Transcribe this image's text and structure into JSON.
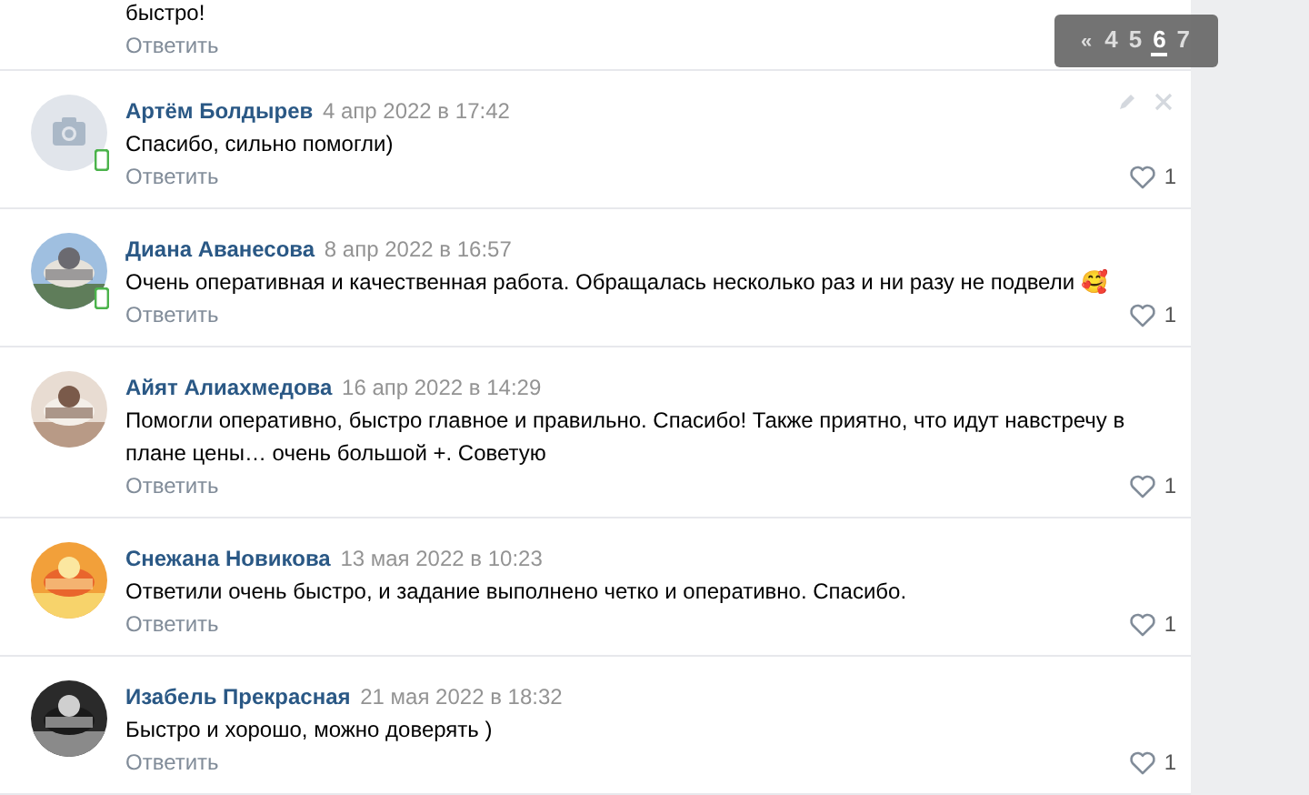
{
  "comments": [
    {
      "kind": "tail",
      "text": "быстро!",
      "reply": "Ответить"
    },
    {
      "author": "Артём Болдырев",
      "date": "4 апр 2022 в 17:42",
      "text": "Спасибо, сильно помогли)",
      "reply": "Ответить",
      "likes": "1",
      "avatar": {
        "kind": "placeholder"
      },
      "online_mobile": true,
      "hover_actions": true
    },
    {
      "author": "Диана Аванесова",
      "date": "8 апр 2022 в 16:57",
      "text": "Очень оперативная и качественная работа. Обращалась несколько раз и ни разу не подвели 🥰",
      "reply": "Ответить",
      "likes": "1",
      "online_mobile": true,
      "hover_actions": false
    },
    {
      "author": "Айят Алиахмедова",
      "date": "16 апр 2022 в 14:29",
      "text": "Помогли оперативно, быстро главное и правильно. Спасибо! Также приятно, что идут навстречу в плане цены… очень большой +. Советую",
      "reply": "Ответить",
      "likes": "1",
      "online_mobile": false,
      "hover_actions": false
    },
    {
      "author": "Снежана Новикова",
      "date": "13 мая 2022 в 10:23",
      "text": "Ответили очень быстро, и задание выполнено четко и оперативно. Спасибо.",
      "reply": "Ответить",
      "likes": "1",
      "online_mobile": false,
      "hover_actions": false
    },
    {
      "author": "Изабель Прекрасная",
      "date": "21 мая 2022 в 18:32",
      "text": "Быстро и хорошо, можно доверять )",
      "reply": "Ответить",
      "likes": "1",
      "online_mobile": false,
      "hover_actions": false
    }
  ],
  "pagination": {
    "prev": "«",
    "pages": [
      {
        "label": "4",
        "selected": false
      },
      {
        "label": "5",
        "selected": false
      },
      {
        "label": "6",
        "selected": true
      },
      {
        "label": "7",
        "selected": false
      }
    ]
  }
}
